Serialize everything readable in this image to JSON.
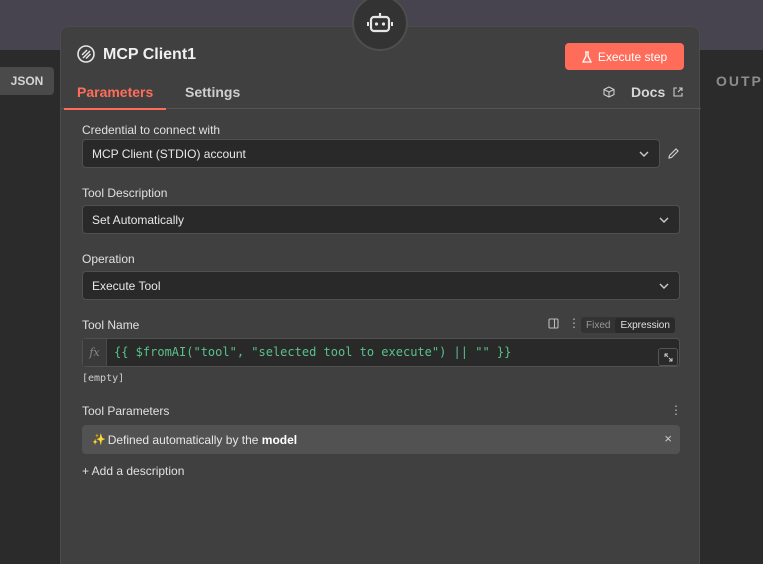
{
  "left": {
    "json_label": "JSON"
  },
  "right": {
    "output_label": "OUTP"
  },
  "header": {
    "title": "MCP Client1",
    "execute_label": "Execute step",
    "tabs": [
      {
        "label": "Parameters"
      },
      {
        "label": "Settings"
      }
    ],
    "docs_label": "Docs"
  },
  "fields": {
    "credential": {
      "label": "Credential to connect with",
      "value": "MCP Client (STDIO) account"
    },
    "tool_description": {
      "label": "Tool Description",
      "value": "Set Automatically"
    },
    "operation": {
      "label": "Operation",
      "value": "Execute Tool"
    },
    "tool_name": {
      "label": "Tool Name",
      "mode_fixed": "Fixed",
      "mode_expression": "Expression",
      "fx": "fx",
      "expression": "{{ $fromAI(\"tool\", \"selected tool to execute\") || \"\" }}",
      "preview": "[empty]"
    },
    "tool_parameters": {
      "label": "Tool Parameters",
      "prefix": "Defined automatically by the ",
      "bold": "model"
    },
    "add_description": "+ Add a description"
  },
  "colors": {
    "accent": "#ff6d5a",
    "expression": "#59c28a"
  }
}
